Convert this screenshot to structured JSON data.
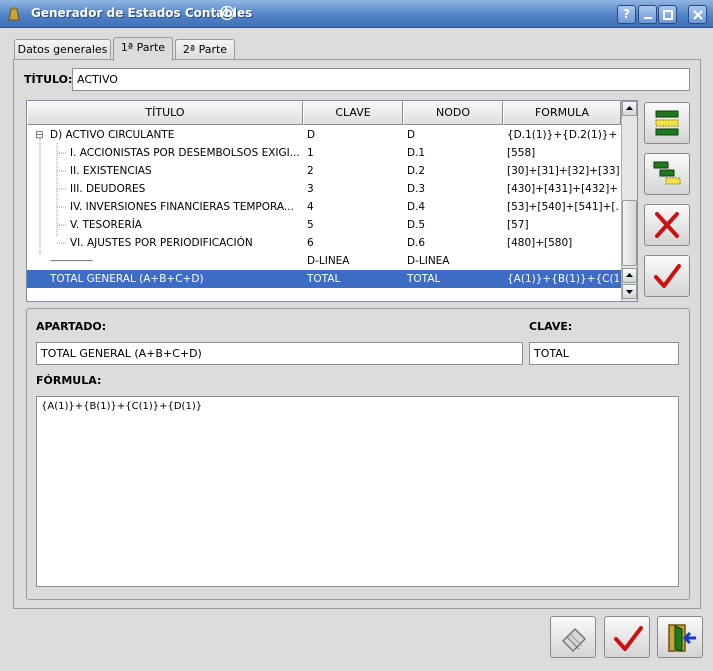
{
  "window": {
    "title": "Generador de Estados Contables",
    "help_label": "?"
  },
  "tabs": [
    {
      "label": "Datos generales",
      "active": false
    },
    {
      "label": "1ª Parte",
      "active": true
    },
    {
      "label": "2ª Parte",
      "active": false
    }
  ],
  "titulo": {
    "label": "TÍTULO:",
    "value": "ACTIVO"
  },
  "grid": {
    "columns": [
      "TÍTULO",
      "CLAVE",
      "NODO",
      "FORMULA"
    ],
    "rows": [
      {
        "titulo": "D) ACTIVO CIRCULANTE",
        "clave": "D",
        "nodo": "D",
        "formula": "{D.1(1)}+{D.2(1)}+{...",
        "level": 0,
        "expander": "⊟",
        "selected": false
      },
      {
        "titulo": "I. ACCIONISTAS POR DESEMBOLSOS EXIGI...",
        "clave": "1",
        "nodo": "D.1",
        "formula": "[558]",
        "level": 1,
        "selected": false
      },
      {
        "titulo": "II. EXISTENCIAS",
        "clave": "2",
        "nodo": "D.2",
        "formula": "[30]+[31]+[32]+[33]...",
        "level": 1,
        "selected": false
      },
      {
        "titulo": "III. DEUDORES",
        "clave": "3",
        "nodo": "D.3",
        "formula": "[430]+[431]+[432]+...",
        "level": 1,
        "selected": false
      },
      {
        "titulo": "IV. INVERSIONES FINANCIERAS TEMPORA...",
        "clave": "4",
        "nodo": "D.4",
        "formula": "[53]+[540]+[541]+[...",
        "level": 1,
        "selected": false
      },
      {
        "titulo": "V. TESORERÍA",
        "clave": "5",
        "nodo": "D.5",
        "formula": "[57]",
        "level": 1,
        "selected": false
      },
      {
        "titulo": "VI. AJUSTES POR PERIODIFICACIÓN",
        "clave": "6",
        "nodo": "D.6",
        "formula": "[480]+[580]",
        "level": 1,
        "selected": false
      },
      {
        "titulo": "——————",
        "clave": "D-LINEA",
        "nodo": "D-LINEA",
        "formula": "",
        "level": 0,
        "selected": false
      },
      {
        "titulo": "TOTAL GENERAL (A+B+C+D)",
        "clave": "TOTAL",
        "nodo": "TOTAL",
        "formula": "{A(1)}+{B(1)}+{C(1)}...",
        "level": 0,
        "selected": true
      }
    ]
  },
  "side_buttons": [
    {
      "icon": "insert-node-icon"
    },
    {
      "icon": "insert-child-icon"
    },
    {
      "icon": "delete-icon"
    },
    {
      "icon": "accept-icon"
    }
  ],
  "detail": {
    "apartado_label": "APARTADO:",
    "apartado_value": "TOTAL GENERAL (A+B+C+D)",
    "clave_label": "CLAVE:",
    "clave_value": "TOTAL",
    "formula_label": "FÓRMULA:",
    "formula_value": "{A(1)}+{B(1)}+{C(1)}+{D(1)}"
  },
  "bottom_buttons": [
    {
      "icon": "eraser-icon"
    },
    {
      "icon": "ok-icon"
    },
    {
      "icon": "exit-icon"
    }
  ],
  "colors": {
    "titlebar": "#5383c7",
    "selection": "#3c6cc4",
    "accept_red": "#cc1111",
    "insert_green": "#1f7a1f",
    "highlight_yellow": "#f4e24a"
  }
}
